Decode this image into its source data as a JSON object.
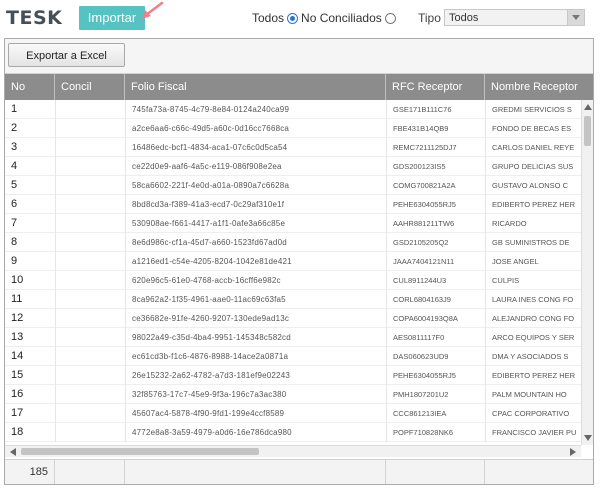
{
  "brand": "TESK",
  "import_button": "Importar",
  "filter": {
    "todos_label": "Todos",
    "no_conciliados_label": "No Conciliados",
    "selected": "Todos",
    "tipo_label": "Tipo",
    "tipo_value": "Todos"
  },
  "toolbar": {
    "export_label": "Exportar a Excel"
  },
  "columns": [
    "No",
    "Concil",
    "Folio Fiscal",
    "RFC Receptor",
    "Nombre Receptor"
  ],
  "rows": [
    {
      "no": "1",
      "concil": "",
      "folio": "745fa73a-8745-4c79-8e84-0124a240ca99",
      "rfc": "GSE171B111C76",
      "nombre": "GREDMI SERVICIOS S"
    },
    {
      "no": "2",
      "concil": "",
      "folio": "a2ce6aa6-c66c-49d5-a60c-0d16cc7668ca",
      "rfc": "FBE431B14QB9",
      "nombre": "FONDO DE BECAS ES"
    },
    {
      "no": "3",
      "concil": "",
      "folio": "16486edc-bcf1-4834-aca1-07c6c0d5ca54",
      "rfc": "REMC7211125DJ7",
      "nombre": "CARLOS DANIEL REYE"
    },
    {
      "no": "4",
      "concil": "",
      "folio": "ce22d0e9-aaf6-4a5c-e119-086f908e2ea",
      "rfc": "GDS200123IS5",
      "nombre": "GRUPO DELICIAS SUS"
    },
    {
      "no": "5",
      "concil": "",
      "folio": "58ca6602-221f-4e0d-a01a-0890a7c6628a",
      "rfc": "COMG700821A2A",
      "nombre": "GUSTAVO ALONSO C"
    },
    {
      "no": "6",
      "concil": "",
      "folio": "8bd8cd3a-f389-41a3-ecd7-0c29af310e1f",
      "rfc": "PEHE6304055RJ5",
      "nombre": "EDIBERTO PEREZ HER"
    },
    {
      "no": "7",
      "concil": "",
      "folio": "530908ae-f661-4417-a1f1-0afe3a66c85e",
      "rfc": "AAHR881211TW6",
      "nombre": "RICARDO"
    },
    {
      "no": "8",
      "concil": "",
      "folio": "8e6d986c-cf1a-45d7-a660-1523fd67ad0d",
      "rfc": "GSD2105205Q2",
      "nombre": "GB SUMINISTROS DE"
    },
    {
      "no": "9",
      "concil": "",
      "folio": "a1216ed1-c54e-4205-8204-1042e81de421",
      "rfc": "JAAA7404121N11",
      "nombre": "JOSE ANGEL"
    },
    {
      "no": "10",
      "concil": "",
      "folio": "620e96c5-61e0-4768-accb-16cff6e982c",
      "rfc": "CUL8911244U3",
      "nombre": "CULPIS"
    },
    {
      "no": "11",
      "concil": "",
      "folio": "8ca962a2-1f35-4961-aae0-11ac69c63fa5",
      "rfc": "CORL6804163J9",
      "nombre": "LAURA INES CONG FO"
    },
    {
      "no": "12",
      "concil": "",
      "folio": "ce36682e-91fe-4260-9207-130ede9ad13c",
      "rfc": "COPA6004193Q8A",
      "nombre": "ALEJANDRO CONG FO"
    },
    {
      "no": "13",
      "concil": "",
      "folio": "98022a49-c35d-4ba4-9951-145348c582cd",
      "rfc": "AES0811117F0",
      "nombre": "ARCO EQUIPOS Y SER"
    },
    {
      "no": "14",
      "concil": "",
      "folio": "ec61cd3b-f1c6-4876-8988-14ace2a0871a",
      "rfc": "DAS060623UD9",
      "nombre": "DMA Y ASOCIADOS S"
    },
    {
      "no": "15",
      "concil": "",
      "folio": "26e15232-2a62-4782-a7d3-181ef9e02243",
      "rfc": "PEHE6304055RJ5",
      "nombre": "EDIBERTO PEREZ HER"
    },
    {
      "no": "16",
      "concil": "",
      "folio": "32f85763-17c7-45e9-9f3a-196c7a3ac380",
      "rfc": "PMH1807201U2",
      "nombre": "PALM MOUNTAIN HO"
    },
    {
      "no": "17",
      "concil": "",
      "folio": "45607ac4-5878-4f90-9fd1-199e4ccf8589",
      "rfc": "CCC861213IEA",
      "nombre": "CPAC CORPORATIVO"
    },
    {
      "no": "18",
      "concil": "",
      "folio": "4772e8a8-3a59-4979-a0d6-16e786dca980",
      "rfc": "POPF710828NK6",
      "nombre": "FRANCISCO JAVIER PU"
    }
  ],
  "footer": {
    "count": "185"
  }
}
